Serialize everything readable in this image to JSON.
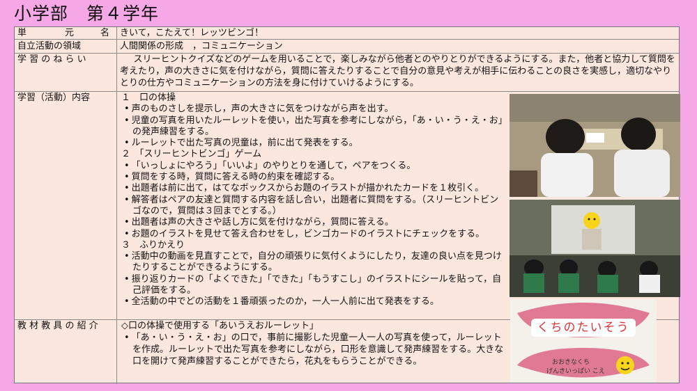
{
  "page": {
    "title": "小学部　第４学年"
  },
  "rows": {
    "unit": {
      "label": "単　　　元　　名",
      "value": "きいて，こたえて！レッツビンゴ！"
    },
    "domain": {
      "label": "自立活動の領域",
      "value": "人間関係の形成　，コミュニケーション"
    },
    "aim": {
      "label": "学 習 の ね ら い",
      "value": "スリーヒントクイズなどのゲームを用いることで，楽しみながら他者とのやりとりができるようにする。また，他者と協力して質問を考えたり，声の大きさに気を付けながら，質問に答えたりすることで自分の意見や考えが相手に伝わることの良さを実感し，適切なやりとりの仕方やコミュニケーションの方法を身に付けていけるようにする。"
    },
    "content": {
      "label": "学習（活動）内容",
      "sections": [
        {
          "heading": "１　口の体操",
          "items": [
            "声のものさしを提示し，声の大きさに気をつけながら声を出す。",
            "児童の写真を用いたルーレットを使い，出た写真を参考にしながら，「あ・い・う・え・お」の発声練習をする。",
            "ルーレットで出た写真の児童は，前に出て発表をする。"
          ]
        },
        {
          "heading": "２　「スリーヒントビンゴ」ゲーム",
          "items": [
            "「いっしょにやろう」「いいよ」のやりとりを通して，ペアをつくる。",
            "質問をする時，質問に答える時の約束を確認する。",
            "出題者は前に出て，はてなボックスからお題のイラストが描かれたカードを１枚引く。",
            "解答者はペアの友達と質問する内容を話し合い，出題者に質問をする。（スリーヒントビンゴなので，質問は３回までとする。）",
            "出題者は声の大きさや話し方に気を付けながら，質問に答える。",
            "お題のイラストを見せて答え合わせをし，ビンゴカードのイラストにチェックをする。"
          ]
        },
        {
          "heading": "３　ふりかえり",
          "items": [
            "活動中の動画を見直すことで，自分の頑張りに気付くようにしたり，友達の良い点を見つけたりすることができるようにする。",
            "振り返りカードの「よくできた」「できた」「もうすこし」のイラストにシールを貼って，自己評価をする。",
            "全活動の中でどの活動を１番頑張ったのか，一人一人前に出て発表をする。"
          ]
        }
      ]
    },
    "materials": {
      "label": "教 材 教 具 の 紹 介",
      "heading": "◇口の体操で使用する「あいうえおルーレット」",
      "item": "「あ・い・う・え・お」の口で，事前に撮影した児童一人一人の写真を使って，ルーレットを作成。ルーレットで出た写真を参考にしながら，口形を意識して発声練習をする。大きな口を開けて発声練習することができたら，花丸をもらうことができる。"
    }
  },
  "photos": {
    "roulette_title": "くちのたいそう",
    "roulette_line1": "おおきなくち",
    "roulette_line2": "げんきいっぱい こえ"
  },
  "colors": {
    "background": "#f6a8e6",
    "table": "#fce7de"
  }
}
